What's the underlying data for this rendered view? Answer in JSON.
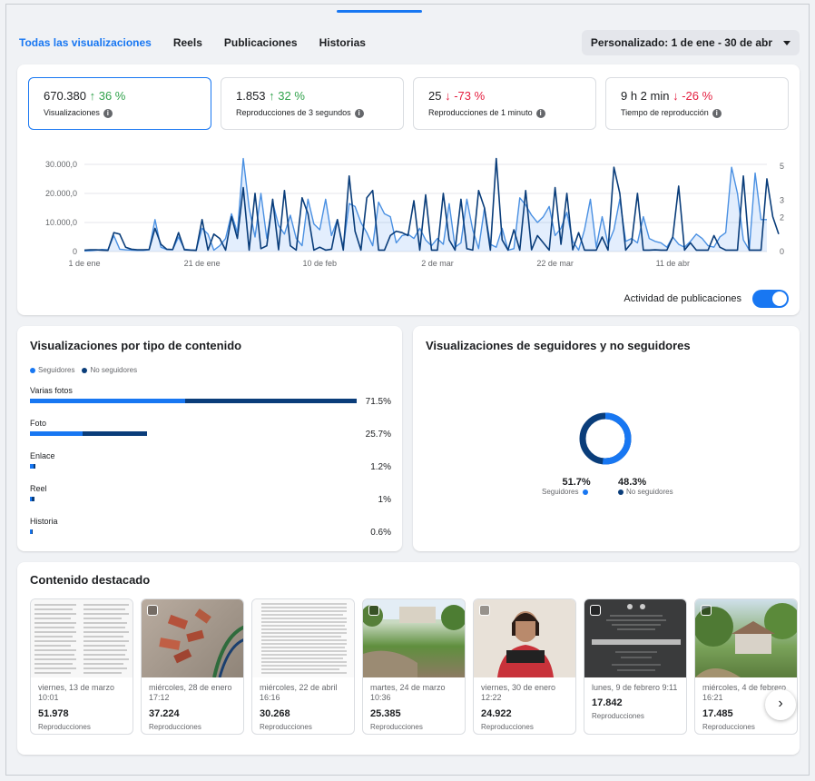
{
  "tabs": [
    {
      "label": "Todas las visualizaciones",
      "active": true
    },
    {
      "label": "Reels",
      "active": false
    },
    {
      "label": "Publicaciones",
      "active": false
    },
    {
      "label": "Historias",
      "active": false
    }
  ],
  "date_range": "Personalizado: 1 de ene - 30 de abr",
  "metrics": [
    {
      "value": "670.380",
      "change": "↑ 36 %",
      "direction": "up",
      "label": "Visualizaciones"
    },
    {
      "value": "1.853",
      "change": "↑ 32 %",
      "direction": "up",
      "label": "Reproducciones de 3 segundos"
    },
    {
      "value": "25",
      "change": "↓ -73 %",
      "direction": "down",
      "label": "Reproducciones de 1 minuto"
    },
    {
      "value": "9 h 2 min",
      "change": "↓ -26 %",
      "direction": "down",
      "label": "Tiempo de reproducción"
    }
  ],
  "chart_data": {
    "type": "line",
    "x_ticks": [
      "1 de ene",
      "21 de ene",
      "10 de feb",
      "2 de mar",
      "22 de mar",
      "11 de abr"
    ],
    "y_left_ticks": [
      "30.000,0",
      "20.000,0",
      "10.000,0",
      "0"
    ],
    "y_left_range": [
      0,
      30000
    ],
    "y_right_ticks": [
      "5",
      "3",
      "2",
      "0"
    ],
    "series": [
      {
        "values": [
          200,
          300,
          500,
          700,
          600,
          5500,
          800,
          600,
          500,
          400,
          400,
          600,
          11000,
          1500,
          700,
          600,
          5000,
          800,
          600,
          500,
          8000,
          6000,
          500,
          2000,
          4500,
          13000,
          6500,
          32000,
          15000,
          5000,
          20000,
          4500,
          17000,
          9000,
          6000,
          12500,
          4500,
          2000,
          18000,
          9500,
          7500,
          18000,
          5500,
          11000,
          1500,
          16500,
          15500,
          10000,
          6500,
          2000,
          17000,
          13000,
          12000,
          3000,
          5500,
          6000,
          4500,
          8000,
          4000,
          2000,
          4500,
          2500,
          16500,
          1500,
          3000,
          18000,
          7500,
          1000,
          15000,
          2500,
          1500,
          8000,
          500,
          1000,
          18500,
          16000,
          12500,
          10000,
          12000,
          15500,
          5500,
          8000,
          13500,
          3500,
          500,
          7500,
          18000,
          1500,
          12000,
          2500,
          7500,
          18000,
          3500,
          4500,
          3000,
          12000,
          4500,
          3500,
          3000,
          1500,
          5000,
          2500,
          1500,
          3500,
          6000,
          4500,
          2000,
          1500,
          5000,
          6500,
          29000,
          20000,
          4000,
          500,
          27000,
          11000,
          11000
        ]
      },
      {
        "values": [
          500,
          600,
          600,
          500,
          400,
          6500,
          6000,
          1500,
          800,
          600,
          600,
          700,
          8000,
          2500,
          800,
          700,
          6500,
          600,
          500,
          400,
          11000,
          500,
          6000,
          4500,
          500,
          12000,
          4500,
          22000,
          500,
          20000,
          1000,
          2000,
          18000,
          600,
          21000,
          2000,
          500,
          18500,
          13000,
          500,
          1500,
          500,
          800,
          11000,
          500,
          26000,
          7000,
          500,
          18500,
          21000,
          500,
          500,
          5500,
          7000,
          6500,
          5500,
          17500,
          500,
          19500,
          500,
          500,
          20000,
          4000,
          500,
          18000,
          1000,
          500,
          21000,
          15000,
          500,
          32000,
          4000,
          500,
          7500,
          500,
          21000,
          600,
          5500,
          3000,
          500,
          22000,
          2500,
          20000,
          600,
          6500,
          500,
          500,
          500,
          5000,
          500,
          29000,
          20000,
          500,
          3000,
          20000,
          500,
          500,
          600,
          500,
          500,
          5000,
          22500,
          500,
          3000,
          500,
          500,
          500,
          5500,
          1500,
          500,
          500,
          500,
          26000,
          500,
          500,
          500,
          25000,
          12000,
          6000
        ]
      }
    ]
  },
  "activity_label": "Actividad de publicaciones",
  "by_type": {
    "title": "Visualizaciones por tipo de contenido",
    "legend_followers": "Seguidores",
    "legend_nonfollowers": "No seguidores",
    "rows": [
      {
        "label": "Varias fotos",
        "pct": "71.5%",
        "followers": 0.475,
        "nonfollowers": 0.525
      },
      {
        "label": "Foto",
        "pct": "25.7%",
        "followers": 0.45,
        "nonfollowers": 0.55
      },
      {
        "label": "Enlace",
        "pct": "1.2%",
        "followers": 0.6,
        "nonfollowers": 0.4
      },
      {
        "label": "Reel",
        "pct": "1%",
        "followers": 0.3,
        "nonfollowers": 0.7
      },
      {
        "label": "Historia",
        "pct": "0.6%",
        "followers": 0.6,
        "nonfollowers": 0.4
      }
    ]
  },
  "followers": {
    "title": "Visualizaciones de seguidores y no seguidores",
    "followers_pct": "51.7%",
    "followers_label": "Seguidores",
    "nonfollowers_pct": "48.3%",
    "nonfollowers_label": "No seguidores",
    "followers_value": 0.517
  },
  "featured": {
    "title": "Contenido destacado",
    "items": [
      {
        "date": "viernes, 13 de marzo 10:01",
        "value": "51.978",
        "label": "Reproducciones",
        "thumb": "document-list"
      },
      {
        "date": "miércoles, 28 de enero 17:12",
        "value": "37.224",
        "label": "Reproducciones",
        "thumb": "bricks"
      },
      {
        "date": "miércoles, 22 de abril 16:16",
        "value": "30.268",
        "label": "Reproducciones",
        "thumb": "document-text"
      },
      {
        "date": "martes, 24 de marzo 10:36",
        "value": "25.385",
        "label": "Reproducciones",
        "thumb": "garden"
      },
      {
        "date": "viernes, 30 de enero 12:22",
        "value": "24.922",
        "label": "Reproducciones",
        "thumb": "person"
      },
      {
        "date": "lunes, 9 de febrero 9:11",
        "value": "17.842",
        "label": "Reproducciones",
        "thumb": "obituary"
      },
      {
        "date": "miércoles, 4 de febrero 16:21",
        "value": "17.485",
        "label": "Reproducciones",
        "thumb": "house"
      }
    ]
  },
  "colors": {
    "accent": "#1877f2",
    "dark_series": "#0a3d7a",
    "up": "#31a24c",
    "down": "#e41e3f"
  }
}
